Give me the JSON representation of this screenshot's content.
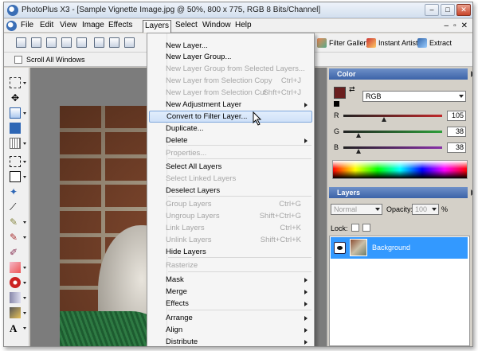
{
  "window": {
    "title": "PhotoPlus X3 - [Sample Vignette Image.jpg @ 50%, 800 x 775, RGB 8 Bits/Channel]"
  },
  "menubar": {
    "items": [
      "File",
      "Edit",
      "View",
      "Image",
      "Effects",
      "Layers",
      "Select",
      "Window",
      "Help"
    ],
    "active": "Layers"
  },
  "toolbar": {
    "filter_gallery": "Filter Gallery",
    "instant_artist": "Instant Artist",
    "extract": "Extract",
    "scroll_all_windows": "Scroll All Windows"
  },
  "layers_menu": {
    "items": [
      {
        "label": "New Layer...",
        "disabled": false
      },
      {
        "label": "New Layer Group...",
        "disabled": false
      },
      {
        "label": "New Layer Group from Selected Layers...",
        "disabled": true
      },
      {
        "label": "New Layer from Selection Copy",
        "shortcut": "Ctrl+J",
        "disabled": true
      },
      {
        "label": "New Layer from Selection Cut",
        "shortcut": "Shft+Ctrl+J",
        "disabled": true
      },
      {
        "label": "New Adjustment Layer",
        "submenu": true,
        "disabled": false
      },
      {
        "label": "Convert to Filter Layer...",
        "highlight": true,
        "disabled": false
      },
      {
        "label": "Duplicate...",
        "disabled": false
      },
      {
        "label": "Delete",
        "submenu": true,
        "disabled": false
      },
      {
        "label": "Properties...",
        "disabled": true
      },
      {
        "label": "Select All Layers",
        "disabled": false
      },
      {
        "label": "Select Linked Layers",
        "disabled": true
      },
      {
        "label": "Deselect Layers",
        "disabled": false
      },
      {
        "label": "Group Layers",
        "shortcut": "Ctrl+G",
        "disabled": true
      },
      {
        "label": "Ungroup Layers",
        "shortcut": "Shift+Ctrl+G",
        "disabled": true
      },
      {
        "label": "Link Layers",
        "shortcut": "Ctrl+K",
        "disabled": true
      },
      {
        "label": "Unlink Layers",
        "shortcut": "Shift+Ctrl+K",
        "disabled": true
      },
      {
        "label": "Hide Layers",
        "disabled": false
      },
      {
        "label": "Rasterize",
        "disabled": true
      },
      {
        "label": "Mask",
        "submenu": true,
        "disabled": false
      },
      {
        "label": "Merge",
        "submenu": true,
        "disabled": false
      },
      {
        "label": "Effects",
        "submenu": true,
        "disabled": false
      },
      {
        "label": "Arrange",
        "submenu": true,
        "disabled": false
      },
      {
        "label": "Align",
        "submenu": true,
        "disabled": false
      },
      {
        "label": "Distribute",
        "submenu": true,
        "disabled": false
      }
    ]
  },
  "color_panel": {
    "title": "Color",
    "mode": "RGB",
    "foreground": "#6a1f1f",
    "channels": [
      {
        "label": "R",
        "value": "105",
        "fraction": 0.41,
        "color": "#c0282a"
      },
      {
        "label": "G",
        "value": "38",
        "fraction": 0.15,
        "color": "#2e9e3a"
      },
      {
        "label": "B",
        "value": "38",
        "fraction": 0.15,
        "color": "#8830a8"
      }
    ]
  },
  "layers_panel": {
    "title": "Layers",
    "blend_mode": "Normal",
    "opacity_label": "Opacity:",
    "opacity_value": "100",
    "opacity_unit": "%",
    "lock_label": "Lock:",
    "layer_name": "Background"
  }
}
